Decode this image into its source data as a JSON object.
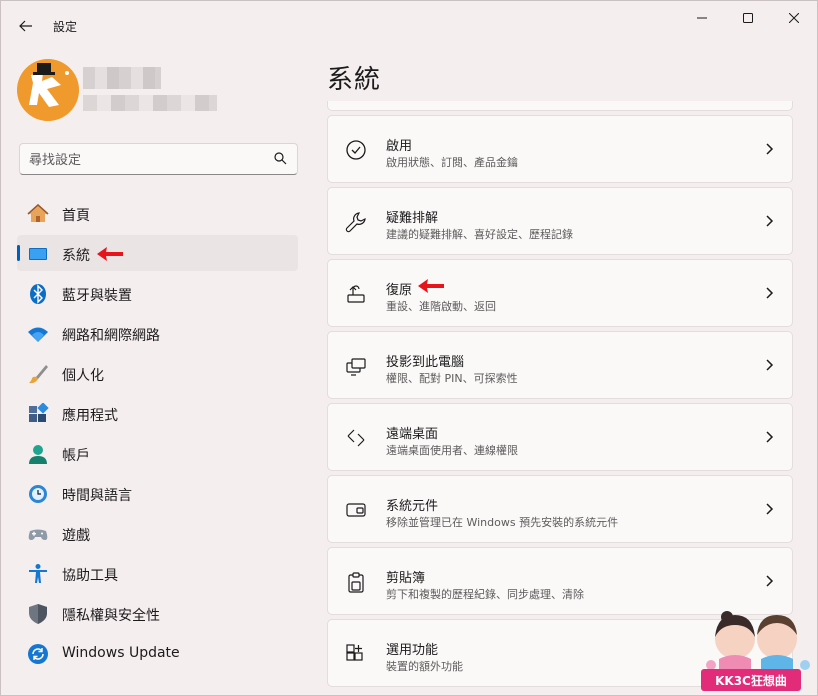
{
  "window": {
    "title": "設定"
  },
  "search": {
    "placeholder": "尋找設定"
  },
  "nav": [
    {
      "label": "首頁",
      "icon": "home-icon"
    },
    {
      "label": "系統",
      "icon": "system-display-icon"
    },
    {
      "label": "藍牙與裝置",
      "icon": "bluetooth-icon"
    },
    {
      "label": "網路和網際網路",
      "icon": "wifi-icon"
    },
    {
      "label": "個人化",
      "icon": "paintbrush-icon"
    },
    {
      "label": "應用程式",
      "icon": "apps-icon"
    },
    {
      "label": "帳戶",
      "icon": "account-icon"
    },
    {
      "label": "時間與語言",
      "icon": "time-language-icon"
    },
    {
      "label": "遊戲",
      "icon": "gamepad-icon"
    },
    {
      "label": "協助工具",
      "icon": "accessibility-icon"
    },
    {
      "label": "隱私權與安全性",
      "icon": "shield-icon"
    },
    {
      "label": "Windows Update",
      "icon": "windows-update-icon"
    }
  ],
  "main": {
    "title": "系統",
    "cards": [
      {
        "title": "啟用",
        "desc": "啟用狀態、訂閱、產品金鑰",
        "icon": "activation-check-icon"
      },
      {
        "title": "疑難排解",
        "desc": "建議的疑難排解、喜好設定、歷程記錄",
        "icon": "wrench-icon"
      },
      {
        "title": "復原",
        "desc": "重設、進階啟動、返回",
        "icon": "recovery-icon"
      },
      {
        "title": "投影到此電腦",
        "desc": "權限、配對 PIN、可探索性",
        "icon": "project-icon"
      },
      {
        "title": "遠端桌面",
        "desc": "遠端桌面使用者、連線權限",
        "icon": "remote-desktop-icon"
      },
      {
        "title": "系統元件",
        "desc": "移除並管理已在 Windows 預先安裝的系統元件",
        "icon": "system-components-icon"
      },
      {
        "title": "剪貼簿",
        "desc": "剪下和複製的歷程紀錄、同步處理、清除",
        "icon": "clipboard-icon"
      },
      {
        "title": "選用功能",
        "desc": "裝置的額外功能",
        "icon": "optional-features-icon"
      }
    ]
  },
  "watermark": {
    "text": "KK3C狂想曲"
  },
  "colors": {
    "accent": "#005fb8",
    "annotation_arrow": "#e8141b",
    "background": "#f5eeef",
    "card": "#fbf8f8"
  }
}
